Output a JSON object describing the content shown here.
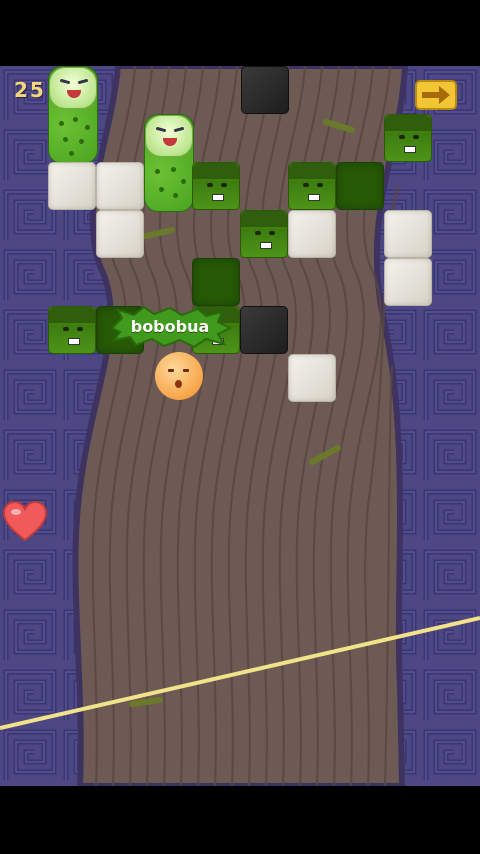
{
  "hud": {
    "score": "25",
    "lives": 1
  },
  "speech": {
    "text": "bobobua"
  },
  "icons": {
    "next": "arrow-right-icon",
    "life": "heart-icon"
  },
  "colors": {
    "score": "#f3d87a",
    "wall": "#4a4580",
    "path": "#6e5a55",
    "rope": "#f2e28a",
    "ball": "#f7a54a"
  }
}
